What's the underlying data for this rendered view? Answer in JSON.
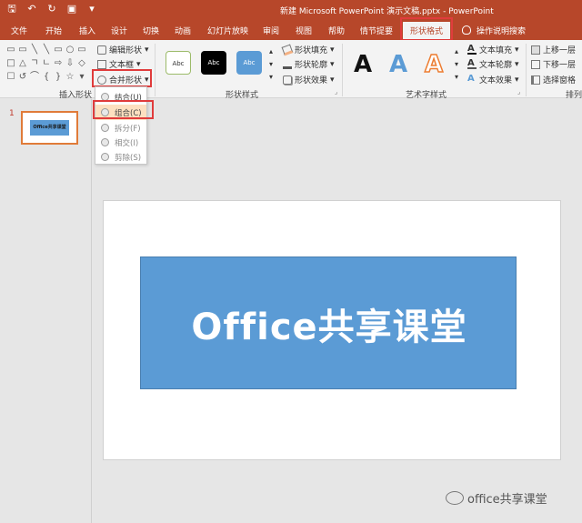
{
  "window": {
    "title": "新建 Microsoft PowerPoint 演示文稿.pptx  -  PowerPoint",
    "qat": {
      "save_icon": "save-icon",
      "undo_icon": "undo-icon",
      "redo_icon": "repeat-icon",
      "present_icon": "present-icon",
      "more_icon": "customize-icon"
    }
  },
  "tabs": [
    "文件",
    "开始",
    "插入",
    "设计",
    "切换",
    "动画",
    "幻灯片放映",
    "审阅",
    "视图",
    "帮助",
    "情节提要",
    "形状格式"
  ],
  "active_tab": "形状格式",
  "tell_me": "操作说明搜索",
  "ribbon": {
    "insert_shapes": {
      "label": "插入形状",
      "shape_glyphs": [
        "▭",
        "▭",
        "╲",
        "╲",
        "▭",
        "○",
        "▭",
        "□",
        "△",
        "ㄱ",
        "ㄴ",
        "⇨",
        "⇩",
        "◇",
        "☐",
        "↺",
        "⌒",
        "{",
        "}",
        "☆",
        "▾"
      ],
      "edit_shape": "编辑形状",
      "text_box": "文本框",
      "merge_shapes": "合并形状"
    },
    "shape_styles": {
      "label": "形状样式",
      "thumbs": [
        {
          "text": "Abc",
          "style": "outline"
        },
        {
          "text": "Abc",
          "style": "black"
        },
        {
          "text": "Abc",
          "style": "blue"
        }
      ],
      "fill": "形状填充",
      "outline": "形状轮廓",
      "effects": "形状效果"
    },
    "wordart": {
      "label": "艺术字样式",
      "letters": [
        {
          "char": "A",
          "color": "#111111"
        },
        {
          "char": "A",
          "color": "#5b9bd5"
        },
        {
          "char": "A",
          "color": "#f4b183"
        }
      ],
      "text_fill": "文本填充",
      "text_outline": "文本轮廓",
      "text_effects": "文本效果"
    },
    "arrange": {
      "label": "排列",
      "bring_forward": "上移一层",
      "send_backward": "下移一层",
      "selection_pane": "选择窗格"
    }
  },
  "merge_menu": {
    "items": [
      {
        "label": "结合(U)",
        "state": "normal"
      },
      {
        "label": "组合(C)",
        "state": "hover"
      },
      {
        "label": "拆分(F)",
        "state": "dim"
      },
      {
        "label": "相交(I)",
        "state": "dim"
      },
      {
        "label": "剪除(S)",
        "state": "dim"
      }
    ]
  },
  "thumbnails": {
    "slide_number": "1",
    "thumb_text": "Office共享课堂"
  },
  "slide": {
    "banner_text": "Office共享课堂",
    "banner_color": "#5b9bd5"
  },
  "watermark": "office共享课堂",
  "colors": {
    "accent": "#b7472a",
    "highlight": "#e03c3c"
  }
}
